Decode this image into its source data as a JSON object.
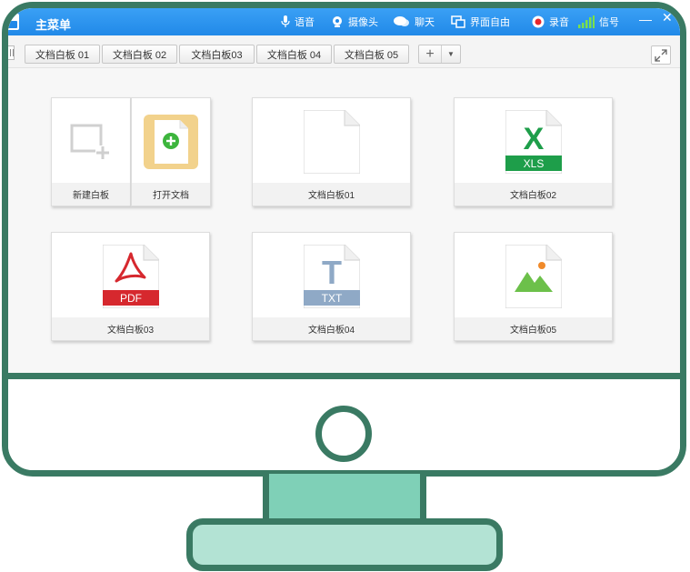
{
  "window": {
    "title": "主菜单",
    "toolbar": [
      {
        "label": "语音",
        "icon": "microphone-icon"
      },
      {
        "label": "摄像头",
        "icon": "camera-icon"
      },
      {
        "label": "聊天",
        "icon": "chat-icon"
      },
      {
        "label": "界面自由",
        "icon": "layout-icon"
      },
      {
        "label": "录音",
        "icon": "record-icon"
      },
      {
        "label": "信号",
        "icon": "signal-icon"
      }
    ],
    "minimize": "—",
    "close": "✕"
  },
  "tabs": [
    "文档白板 01",
    "文档白板 02",
    "文档白板03",
    "文档白板 04",
    "文档白板 05"
  ],
  "tab_add": {
    "plus": "+",
    "caret": "▼"
  },
  "cards": {
    "new_whiteboard": "新建白板",
    "open_document": "打开文档",
    "doc1": {
      "label": "文档白板01"
    },
    "doc2": {
      "label": "文档白板02",
      "badge": "XLS",
      "glyph": "X"
    },
    "doc3": {
      "label": "文档白板03",
      "badge": "PDF"
    },
    "doc4": {
      "label": "文档白板04",
      "badge": "TXT",
      "glyph": "T"
    },
    "doc5": {
      "label": "文档白板05"
    }
  },
  "colors": {
    "titlebar": "#2189e8",
    "monitor_frame": "#3a7a63",
    "stand_neck": "#7fd0b7",
    "stand_base": "#b3e3d4",
    "xls": "#1e9e4a",
    "pdf": "#d6282e",
    "txt": "#8fa9c6",
    "image": "#6cc04a",
    "open_doc": "#f2d28c"
  }
}
